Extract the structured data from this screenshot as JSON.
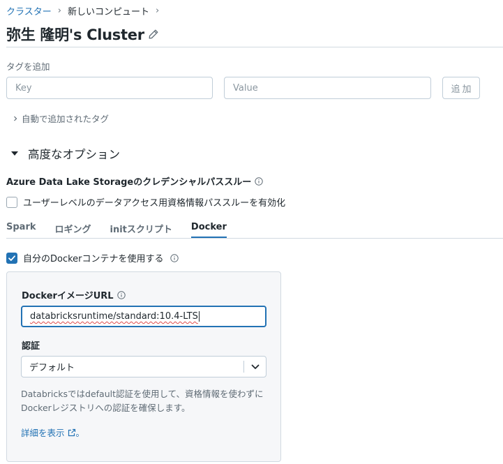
{
  "breadcrumb": {
    "parent": "クラスター",
    "current": "新しいコンピュート"
  },
  "page": {
    "title": "弥生 隆明's Cluster"
  },
  "tags": {
    "label": "タグを追加",
    "key_placeholder": "Key",
    "value_placeholder": "Value",
    "add_label": "追加",
    "auto_added_label": "自動で追加されたタグ"
  },
  "advanced": {
    "label": "高度なオプション",
    "adls_label": "Azure Data Lake Storageのクレデンシャルパススルー",
    "passthrough_label": "ユーザーレベルのデータアクセス用資格情報パススルーを有効化",
    "passthrough_checked": false
  },
  "tabs": [
    {
      "label": "Spark",
      "active": false
    },
    {
      "label": "ロギング",
      "active": false
    },
    {
      "label": "initスクリプト",
      "active": false
    },
    {
      "label": "Docker",
      "active": true
    }
  ],
  "docker": {
    "use_label": "自分のDockerコンテナを使用する",
    "use_checked": true,
    "url_label": "DockerイメージURL",
    "url_value": "databricksruntime/standard:10.4-LTS",
    "auth_label": "認証",
    "auth_value": "デフォルト",
    "description_line1": "Databricksではdefault認証を使用して、資格情報を使わずに",
    "description_line2": "Dockerレジストリへの認証を確保します。",
    "more_link": "詳細を表示",
    "more_suffix": "。"
  },
  "colors": {
    "accent": "#2272b4",
    "text": "#1f272d",
    "muted": "#5f6b75",
    "border": "#c0cdd8"
  }
}
